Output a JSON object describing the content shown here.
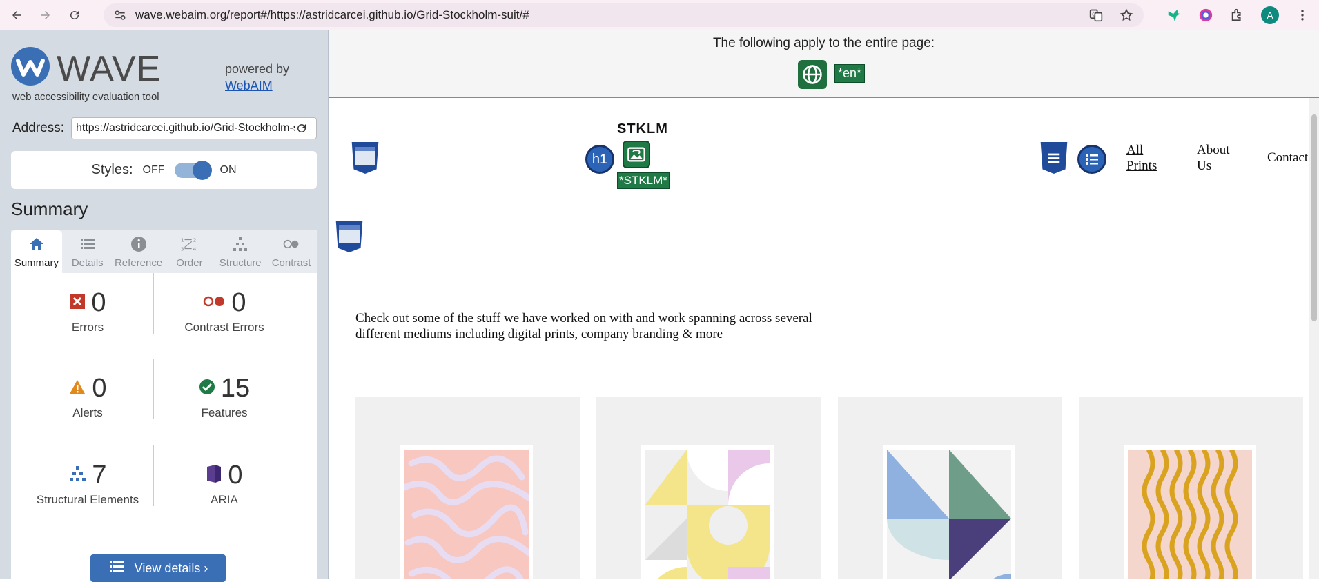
{
  "browser": {
    "url": "wave.webaim.org/report#/https://astridcarcei.github.io/Grid-Stockholm-suit/#",
    "avatar_letter": "A"
  },
  "wave": {
    "logo_word": "WAVE",
    "tagline": "web accessibility evaluation tool",
    "powered_by": "powered by",
    "webaim_link": "WebAIM",
    "address_label": "Address:",
    "address_value": "https://astridcarcei.github.io/Grid-Stockholm-suit/#",
    "styles_label": "Styles:",
    "styles_off": "OFF",
    "styles_on": "ON",
    "summary_title": "Summary",
    "tabs": [
      {
        "label": "Summary",
        "icon": "home-icon"
      },
      {
        "label": "Details",
        "icon": "list-icon"
      },
      {
        "label": "Reference",
        "icon": "info-icon"
      },
      {
        "label": "Order",
        "icon": "order-icon"
      },
      {
        "label": "Structure",
        "icon": "structure-icon"
      },
      {
        "label": "Contrast",
        "icon": "contrast-icon"
      }
    ],
    "stats": {
      "errors": {
        "count": "0",
        "label": "Errors"
      },
      "contrast_errors": {
        "count": "0",
        "label": "Contrast Errors"
      },
      "alerts": {
        "count": "0",
        "label": "Alerts"
      },
      "features": {
        "count": "15",
        "label": "Features"
      },
      "structural": {
        "count": "7",
        "label": "Structural Elements"
      },
      "aria": {
        "count": "0",
        "label": "ARIA"
      }
    },
    "view_details": "View details ›"
  },
  "page": {
    "apply_text": "The following apply to the entire page:",
    "lang_badge": "*en*",
    "site_title": "STKLM",
    "alt_badge": "*STKLM*",
    "h1_badge": "h1",
    "nav": [
      "All Prints",
      "About Us",
      "Contact"
    ],
    "intro": "Check out some of the stuff we have worked on with and work spanning across several different mediums including digital prints, company branding & more"
  },
  "colors": {
    "wave_blue": "#3a6fb6",
    "feature_green": "#1f7a45",
    "error_red": "#c0392b",
    "alert_orange": "#e08a1e",
    "aria_purple": "#5b3d8f"
  }
}
